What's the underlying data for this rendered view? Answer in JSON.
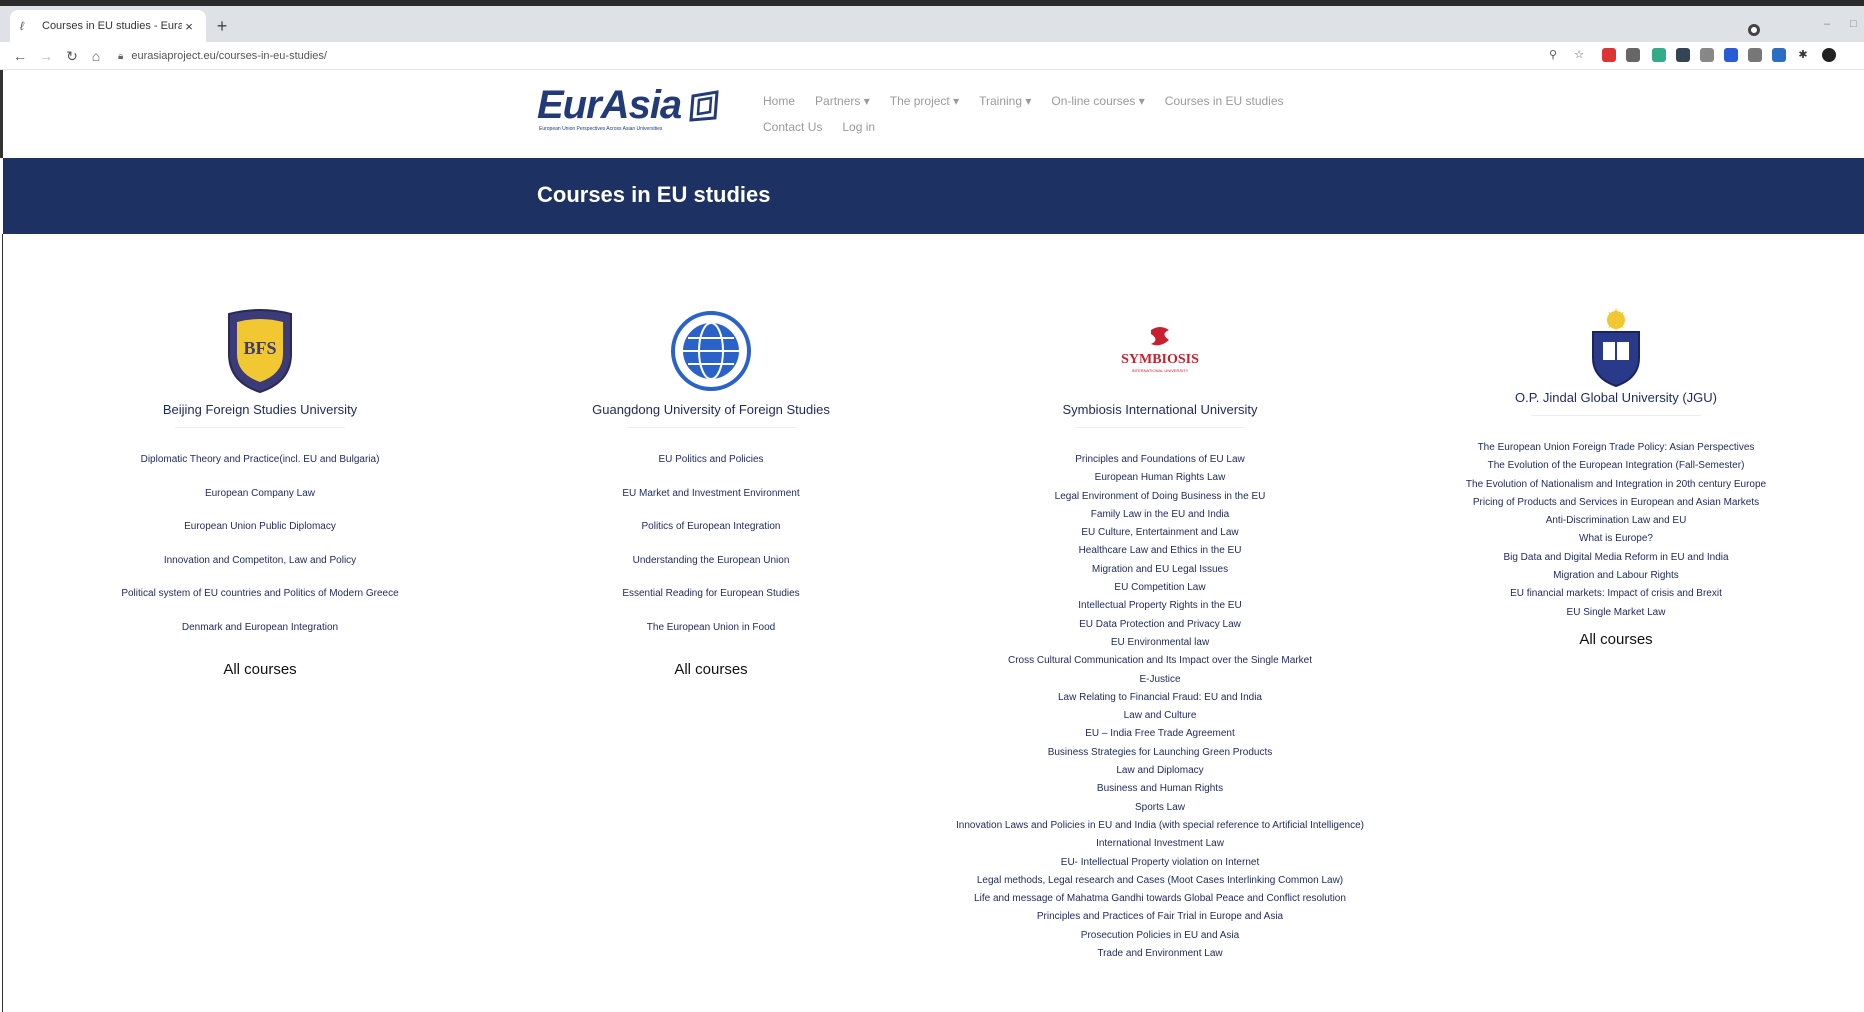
{
  "browser": {
    "tab_title": "Courses in EU studies - Eurasia",
    "url": "eurasiaproject.eu/courses-in-eu-studies/"
  },
  "site": {
    "logo_text": "EurAsia",
    "logo_tagline": "European Union Perspectives Across Asian Universities",
    "menu_row1": [
      "Home",
      "Partners ▾",
      "The project ▾",
      "Training ▾",
      "On-line courses ▾",
      "Courses in EU studies"
    ],
    "menu_row2": [
      "Contact Us",
      "Log in"
    ]
  },
  "banner": {
    "title": "Courses in EU studies"
  },
  "colors": {
    "banner": "#1e3163",
    "link": "#1d2a5a",
    "logo": "#233a79"
  },
  "universities": [
    {
      "name": "Beijing Foreign Studies University",
      "logo_icon": "bfsu-crest-icon",
      "courses": [
        "Diplomatic Theory and Practice(incl. EU and Bulgaria)",
        "European Company Law",
        "European Union Public Diplomacy",
        "Innovation and Competiton, Law and Policy",
        "Political system of EU countries and Politics of Modern Greece",
        "Denmark and European Integration"
      ],
      "all_courses": "All courses"
    },
    {
      "name": "Guangdong University of Foreign Studies",
      "logo_icon": "gdufs-globe-icon",
      "courses": [
        "EU Politics and Policies",
        "EU Market and Investment Environment",
        "Politics of European Integration",
        "Understanding the European Union",
        "Essential Reading for European Studies",
        "The European Union in Food"
      ],
      "all_courses": "All courses"
    },
    {
      "name": "Symbiosis International University",
      "logo_icon": "symbiosis-logo-icon",
      "logo_text": "SYMBIOSIS",
      "logo_subtext": "INTERNATIONAL UNIVERSITY",
      "courses": [
        "Principles and Foundations of EU Law",
        "European Human Rights Law",
        "Legal Environment of Doing Business in the EU",
        "Family Law in the EU and India",
        "EU Culture, Entertainment and Law",
        "Healthcare Law and Ethics in the EU",
        "Migration and EU Legal Issues",
        "EU Competition Law",
        "Intellectual Property Rights in the EU",
        "EU Data Protection and Privacy Law",
        "EU Environmental law",
        "Cross Cultural Communication and Its Impact over the Single Market",
        "E-Justice",
        "Law Relating to Financial Fraud: EU and India",
        "Law and Culture",
        "EU – India Free Trade Agreement",
        "Business Strategies for Launching Green Products",
        "Law and Diplomacy",
        "Business and Human Rights",
        "Sports Law",
        "Innovation Laws and Policies in EU and India (with special reference to Artificial Intelligence)",
        "International Investment Law",
        "EU- Intellectual Property violation on Internet",
        "Legal methods, Legal research and Cases (Moot Cases Interlinking Common Law)",
        "Life and message of Mahatma Gandhi towards Global Peace and Conflict resolution",
        "Principles and Practices of Fair Trial in Europe and Asia",
        "Prosecution Policies in EU and Asia",
        "Trade and Environment Law"
      ]
    },
    {
      "name": "O.P. Jindal Global University (JGU)",
      "logo_icon": "jgu-crest-icon",
      "courses": [
        "The European Union Foreign Trade Policy: Asian Perspectives",
        "The Evolution of the European Integration (Fall-Semester)",
        "The Evolution of Nationalism and Integration in 20th century Europe",
        "Pricing of Products and Services in European and Asian Markets",
        "Anti-Discrimination Law and EU",
        "What is Europe?",
        "Big Data and Digital Media Reform in EU and India",
        "Migration and Labour Rights",
        "EU financial markets: Impact of crisis and Brexit",
        "EU Single Market Law"
      ],
      "all_courses": "All courses"
    }
  ]
}
